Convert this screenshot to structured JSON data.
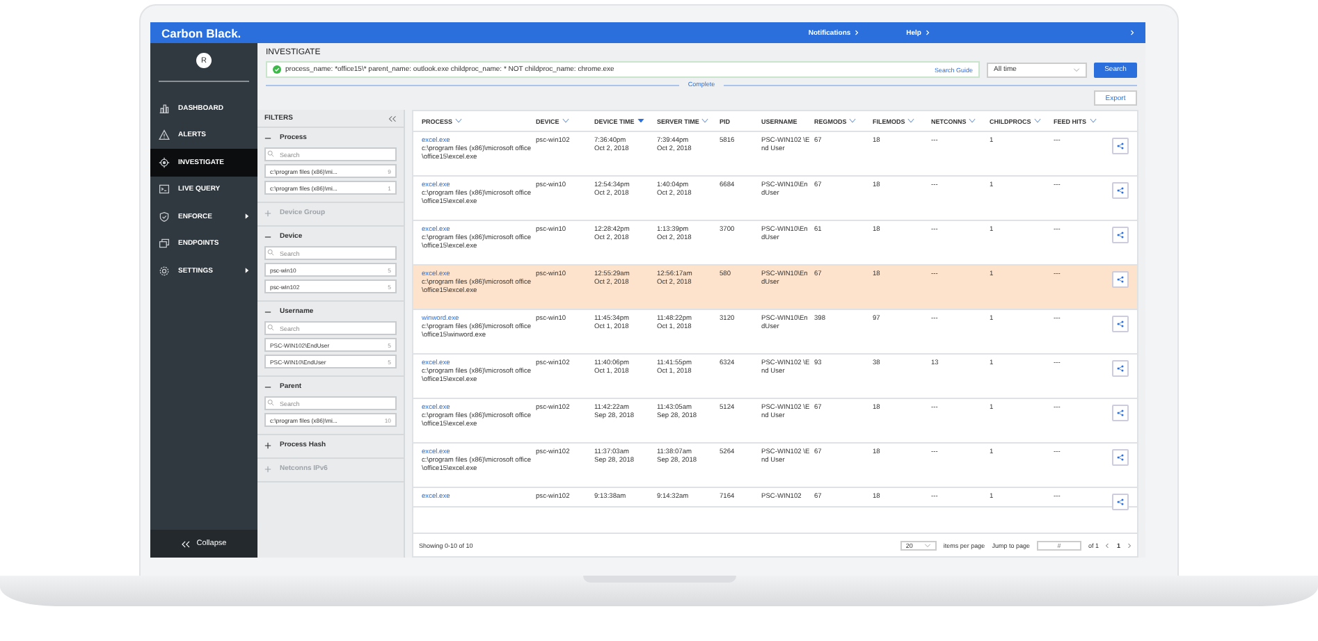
{
  "header": {
    "brand": "Carbon Black.",
    "links": [
      "Notifications",
      "Help"
    ]
  },
  "sidebar": {
    "avatar": "R",
    "items": [
      {
        "label": "DASHBOARD",
        "selected": false,
        "submenu": false
      },
      {
        "label": "ALERTS",
        "selected": false,
        "submenu": false
      },
      {
        "label": "INVESTIGATE",
        "selected": true,
        "submenu": false
      },
      {
        "label": "LIVE QUERY",
        "selected": false,
        "submenu": false
      },
      {
        "label": "ENFORCE",
        "selected": false,
        "submenu": true
      },
      {
        "label": "ENDPOINTS",
        "selected": false,
        "submenu": false
      },
      {
        "label": "SETTINGS",
        "selected": false,
        "submenu": true
      }
    ],
    "collapse": "Collapse"
  },
  "investigate": {
    "title": "INVESTIGATE",
    "query": "process_name: *office15\\* parent_name: outlook.exe childproc_name: * NOT childproc_name: chrome.exe",
    "search_guide": "Search Guide",
    "time_range": "All time",
    "search_button": "Search",
    "status": "Complete",
    "export_button": "Export"
  },
  "filters": {
    "title": "FILTERS",
    "sections": [
      {
        "label": "Process",
        "expanded": true,
        "disabled": false,
        "search_placeholder": "Search",
        "values": [
          {
            "text": "c:\\program files (x86)\\mi...",
            "count": "9"
          },
          {
            "text": "c:\\program files (x86)\\mi...",
            "count": "1"
          }
        ]
      },
      {
        "label": "Device Group",
        "expanded": false,
        "disabled": true
      },
      {
        "label": "Device",
        "expanded": true,
        "disabled": false,
        "search_placeholder": "Search",
        "values": [
          {
            "text": "psc-win10",
            "count": "5"
          },
          {
            "text": "psc-win102",
            "count": "5"
          }
        ]
      },
      {
        "label": "Username",
        "expanded": true,
        "disabled": false,
        "search_placeholder": "Search",
        "values": [
          {
            "text": "PSC-WIN102\\EndUser",
            "count": "5"
          },
          {
            "text": "PSC-WIN10\\EndUser",
            "count": "5"
          }
        ]
      },
      {
        "label": "Parent",
        "expanded": true,
        "disabled": false,
        "search_placeholder": "Search",
        "values": [
          {
            "text": "c:\\program files (x86)\\mi...",
            "count": "10"
          }
        ]
      },
      {
        "label": "Process Hash",
        "expanded": false,
        "disabled": false
      },
      {
        "label": "Netconns IPv6",
        "expanded": false,
        "disabled": true
      }
    ]
  },
  "table": {
    "columns": [
      {
        "label": "PROCESS",
        "sortable": true,
        "sorted": false
      },
      {
        "label": "DEVICE",
        "sortable": true,
        "sorted": false
      },
      {
        "label": "DEVICE TIME",
        "sortable": true,
        "sorted": true
      },
      {
        "label": "SERVER TIME",
        "sortable": true,
        "sorted": false
      },
      {
        "label": "PID",
        "sortable": false
      },
      {
        "label": "USERNAME",
        "sortable": false
      },
      {
        "label": "REGMODS",
        "sortable": true,
        "sorted": false
      },
      {
        "label": "FILEMODS",
        "sortable": true,
        "sorted": false
      },
      {
        "label": "NETCONNS",
        "sortable": true,
        "sorted": false
      },
      {
        "label": "CHILDPROCS",
        "sortable": true,
        "sorted": false
      },
      {
        "label": "FEED HITS",
        "sortable": true,
        "sorted": false
      }
    ],
    "rows": [
      {
        "selected": false,
        "process": "excel.exe",
        "path": "c:\\program files (x86)\\microsoft office\\office15\\excel.exe",
        "device": "psc-win102",
        "device_time": "7:36:40pm",
        "device_date": "Oct 2, 2018",
        "server_time": "7:39:44pm",
        "server_date": "Oct 2, 2018",
        "pid": "5816",
        "username": "PSC-WIN102 \\End User",
        "regmods": "67",
        "filemods": "18",
        "netconns": "---",
        "childprocs": "1",
        "feed_hits": "---"
      },
      {
        "selected": false,
        "process": "excel.exe",
        "path": "c:\\program files (x86)\\microsoft office\\office15\\excel.exe",
        "device": "psc-win10",
        "device_time": "12:54:34pm",
        "device_date": "Oct 2, 2018",
        "server_time": "1:40:04pm",
        "server_date": "Oct 2, 2018",
        "pid": "6684",
        "username": "PSC-WIN10\\EndUser",
        "regmods": "67",
        "filemods": "18",
        "netconns": "---",
        "childprocs": "1",
        "feed_hits": "---"
      },
      {
        "selected": false,
        "process": "excel.exe",
        "path": "c:\\program files (x86)\\microsoft office\\office15\\excel.exe",
        "device": "psc-win10",
        "device_time": "12:28:42pm",
        "device_date": "Oct 2, 2018",
        "server_time": "1:13:39pm",
        "server_date": "Oct 2, 2018",
        "pid": "3700",
        "username": "PSC-WIN10\\EndUser",
        "regmods": "61",
        "filemods": "18",
        "netconns": "---",
        "childprocs": "1",
        "feed_hits": "---"
      },
      {
        "selected": true,
        "process": "excel.exe",
        "path": "c:\\program files (x86)\\microsoft office\\office15\\excel.exe",
        "device": "psc-win10",
        "device_time": "12:55:29am",
        "device_date": "Oct 2, 2018",
        "server_time": "12:56:17am",
        "server_date": "Oct 2, 2018",
        "pid": "580",
        "username": "PSC-WIN10\\EndUser",
        "regmods": "67",
        "filemods": "18",
        "netconns": "---",
        "childprocs": "1",
        "feed_hits": "---"
      },
      {
        "selected": false,
        "process": "winword.exe",
        "path": "c:\\program files (x86)\\microsoft office\\office15\\winword.exe",
        "device": "psc-win10",
        "device_time": "11:45:34pm",
        "device_date": "Oct 1, 2018",
        "server_time": "11:48:22pm",
        "server_date": "Oct 1, 2018",
        "pid": "3120",
        "username": "PSC-WIN10\\EndUser",
        "regmods": "398",
        "filemods": "97",
        "netconns": "---",
        "childprocs": "1",
        "feed_hits": "---"
      },
      {
        "selected": false,
        "process": "excel.exe",
        "path": "c:\\program files (x86)\\microsoft office\\office15\\excel.exe",
        "device": "psc-win102",
        "device_time": "11:40:06pm",
        "device_date": "Oct 1, 2018",
        "server_time": "11:41:55pm",
        "server_date": "Oct 1, 2018",
        "pid": "6324",
        "username": "PSC-WIN102 \\End User",
        "regmods": "93",
        "filemods": "38",
        "netconns": "13",
        "childprocs": "1",
        "feed_hits": "---"
      },
      {
        "selected": false,
        "process": "excel.exe",
        "path": "c:\\program files (x86)\\microsoft office\\office15\\excel.exe",
        "device": "psc-win102",
        "device_time": "11:42:22am",
        "device_date": "Sep 28, 2018",
        "server_time": "11:43:05am",
        "server_date": "Sep 28, 2018",
        "pid": "5124",
        "username": "PSC-WIN102 \\End User",
        "regmods": "67",
        "filemods": "18",
        "netconns": "---",
        "childprocs": "1",
        "feed_hits": "---"
      },
      {
        "selected": false,
        "process": "excel.exe",
        "path": "c:\\program files (x86)\\microsoft office\\office15\\excel.exe",
        "device": "psc-win102",
        "device_time": "11:37:03am",
        "device_date": "Sep 28, 2018",
        "server_time": "11:38:07am",
        "server_date": "Sep 28, 2018",
        "pid": "5264",
        "username": "PSC-WIN102 \\End User",
        "regmods": "67",
        "filemods": "18",
        "netconns": "---",
        "childprocs": "1",
        "feed_hits": "---"
      },
      {
        "selected": false,
        "process": "excel.exe",
        "device": "psc-win102",
        "device_time": "9:13:38am",
        "server_time": "9:14:32am",
        "pid": "7164",
        "username": "PSC-WIN102",
        "regmods": "67",
        "filemods": "18",
        "netconns": "---",
        "childprocs": "1",
        "feed_hits": "---"
      }
    ],
    "footer": {
      "showing": "Showing 0-10 of 10",
      "per_page": "20",
      "per_page_label": "items per page",
      "jump_label": "Jump to page",
      "jump_placeholder": "#",
      "of_pages": "of 1",
      "page": "1"
    }
  }
}
